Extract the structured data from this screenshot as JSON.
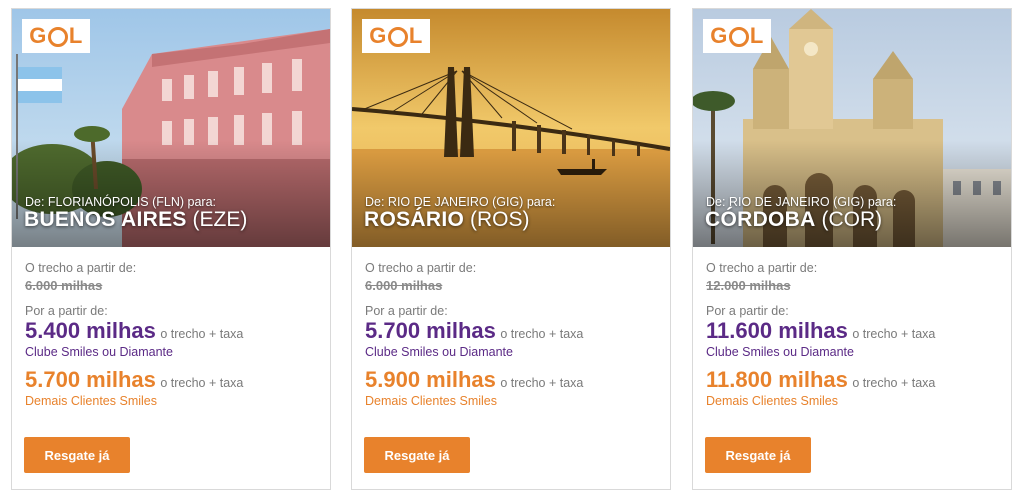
{
  "cards": [
    {
      "logo": "GOL",
      "route": "De: FLORIANÓPOLIS (FLN) para:",
      "dest_city": "BUENOS AIRES",
      "dest_code": "(EZE)",
      "from_label": "O trecho a partir de:",
      "old_price": "6.000 milhas",
      "por_label": "Por a partir de:",
      "price_club": "5.400 milhas",
      "price_club_suffix": "o trecho + taxa",
      "club_label": "Clube Smiles ou Diamante",
      "price_other": "5.700 milhas",
      "price_other_suffix": "o trecho + taxa",
      "other_label": "Demais Clientes Smiles",
      "button": "Resgate já"
    },
    {
      "logo": "GOL",
      "route": "De: RIO DE JANEIRO (GIG) para:",
      "dest_city": "ROSÁRIO",
      "dest_code": "(ROS)",
      "from_label": "O trecho a partir de:",
      "old_price": "6.000 milhas",
      "por_label": "Por a partir de:",
      "price_club": "5.700 milhas",
      "price_club_suffix": "o trecho + taxa",
      "club_label": "Clube Smiles ou Diamante",
      "price_other": "5.900 milhas",
      "price_other_suffix": "o trecho + taxa",
      "other_label": "Demais Clientes Smiles",
      "button": "Resgate já"
    },
    {
      "logo": "GOL",
      "route": "De: RIO DE JANEIRO (GIG) para:",
      "dest_city": "CÓRDOBA",
      "dest_code": "(COR)",
      "from_label": "O trecho a partir de:",
      "old_price": "12.000 milhas",
      "por_label": "Por a partir de:",
      "price_club": "11.600 milhas",
      "price_club_suffix": "o trecho + taxa",
      "club_label": "Clube Smiles ou Diamante",
      "price_other": "11.800 milhas",
      "price_other_suffix": "o trecho + taxa",
      "other_label": "Demais Clientes Smiles",
      "button": "Resgate já"
    }
  ],
  "colors": {
    "brand_orange": "#e8822c",
    "club_purple": "#5b2a86",
    "muted_text": "#7a7a7a"
  }
}
